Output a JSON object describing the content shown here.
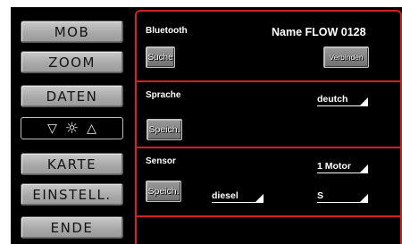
{
  "nav": {
    "mob": "MOB",
    "zoom": "ZOOM",
    "daten": "DATEN",
    "brightness": {
      "down": "▽",
      "sun": "☼",
      "up": "△"
    },
    "karte": "KARTE",
    "einstell": "EINSTELL.",
    "ende": "ENDE"
  },
  "bluetooth": {
    "label": "Bluetooth",
    "name": "Name FLOW 0128",
    "search_btn": "Suche",
    "connect_btn": "Verbinden"
  },
  "language": {
    "label": "Sprache",
    "value": "deutch",
    "save_btn": "Speich."
  },
  "sensor": {
    "label": "Sensor",
    "motor_value": "1 Motor",
    "save_btn": "Speich.",
    "fuel_value": "diesel",
    "unit_value": "S"
  },
  "colors": {
    "accent": "#d42020",
    "background": "#000000"
  }
}
